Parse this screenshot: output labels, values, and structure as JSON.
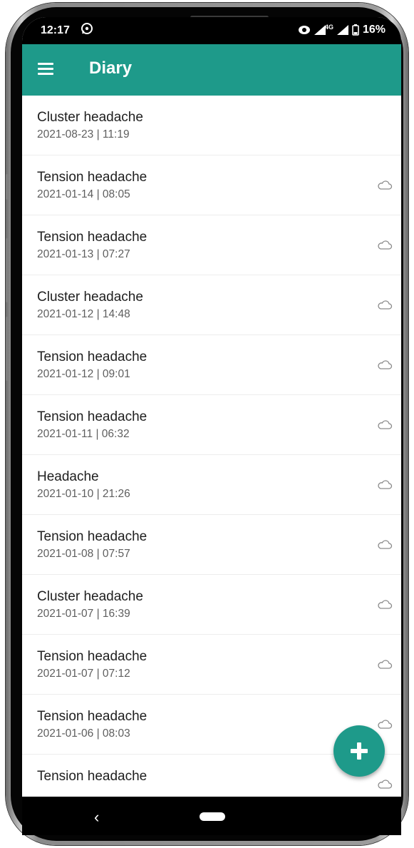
{
  "status_bar": {
    "time": "12:17",
    "network": "4G",
    "battery": "16%",
    "icons": [
      "whatsapp-icon",
      "data-saver-icon",
      "signal-icon",
      "battery-icon"
    ]
  },
  "app_bar": {
    "title": "Diary",
    "menu_icon": "hamburger-menu-icon",
    "color": "#1e9a8a"
  },
  "entries": [
    {
      "title": "Cluster headache",
      "datetime": "2021-08-23 | 11:19",
      "synced": false
    },
    {
      "title": "Tension headache",
      "datetime": "2021-01-14 | 08:05",
      "synced": true
    },
    {
      "title": "Tension headache",
      "datetime": "2021-01-13 | 07:27",
      "synced": true
    },
    {
      "title": "Cluster headache",
      "datetime": "2021-01-12 | 14:48",
      "synced": true
    },
    {
      "title": "Tension headache",
      "datetime": "2021-01-12 | 09:01",
      "synced": true
    },
    {
      "title": "Tension headache",
      "datetime": "2021-01-11 | 06:32",
      "synced": true
    },
    {
      "title": "Headache",
      "datetime": "2021-01-10 | 21:26",
      "synced": true
    },
    {
      "title": "Tension headache",
      "datetime": "2021-01-08 | 07:57",
      "synced": true
    },
    {
      "title": "Cluster headache",
      "datetime": "2021-01-07 | 16:39",
      "synced": true
    },
    {
      "title": "Tension headache",
      "datetime": "2021-01-07 | 07:12",
      "synced": true
    },
    {
      "title": "Tension headache",
      "datetime": "2021-01-06 | 08:03",
      "synced": true
    },
    {
      "title": "Tension headache",
      "datetime": "",
      "synced": true
    }
  ],
  "fab": {
    "icon": "plus-icon",
    "color": "#1e9a8a"
  },
  "nav_bar": {
    "back_icon": "back-chevron-icon",
    "home_icon": "home-pill-icon"
  }
}
